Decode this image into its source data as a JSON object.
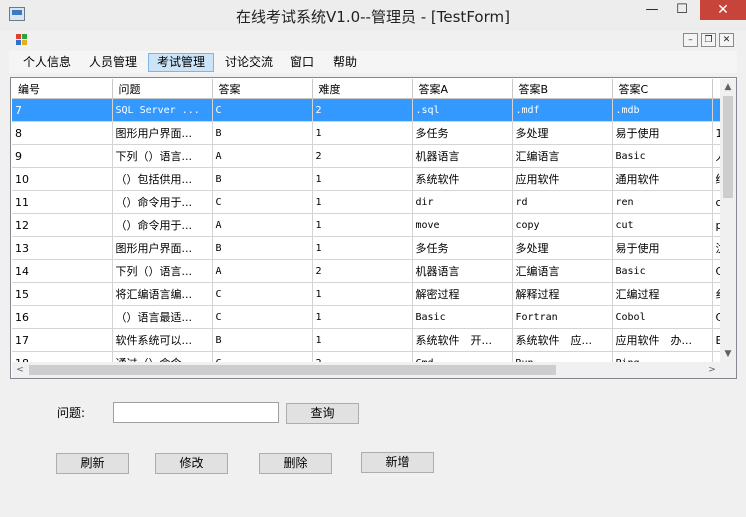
{
  "window": {
    "title": "在线考试系统V1.0--管理员 - [TestForm]",
    "minimize": "—",
    "maximize": "☐",
    "close": "✕"
  },
  "menu": [
    "个人信息",
    "人员管理",
    "考试管理",
    "讨论交流",
    "窗口",
    "帮助"
  ],
  "grid": {
    "columns": [
      "编号",
      "问题",
      "答案",
      "难度",
      "答案A",
      "答案B",
      "答案C",
      ""
    ],
    "rows": [
      [
        "7",
        "SQL Server ...",
        "C",
        "2",
        ".sql",
        ".mdf",
        ".mdb",
        ""
      ],
      [
        "8",
        "图形用户界面...",
        "B",
        "1",
        "多任务",
        "多处理",
        "易于使用",
        "1"
      ],
      [
        "9",
        "下列（）语言...",
        "A",
        "2",
        "机器语言",
        "汇编语言",
        "Basic",
        "人"
      ],
      [
        "10",
        "（）包括供用...",
        "B",
        "1",
        "系统软件",
        "应用软件",
        "通用软件",
        "绉"
      ],
      [
        "11",
        "（）命令用于...",
        "C",
        "1",
        "dir",
        "rd",
        "ren",
        "c"
      ],
      [
        "12",
        "（）命令用于...",
        "A",
        "1",
        "move",
        "copy",
        "cut",
        "p"
      ],
      [
        "13",
        "图形用户界面...",
        "B",
        "1",
        "多任务",
        "多处理",
        "易于使用",
        "汶"
      ],
      [
        "14",
        "下列（）语言...",
        "A",
        "2",
        "机器语言",
        "汇编语言",
        "Basic",
        "C"
      ],
      [
        "15",
        "将汇编语言编...",
        "C",
        "1",
        "解密过程",
        "解释过程",
        "汇编过程",
        "纟"
      ],
      [
        "16",
        "（）语言最适...",
        "C",
        "1",
        "Basic",
        "Fortran",
        "Cobol",
        "C"
      ],
      [
        "17",
        "软件系统可以...",
        "B",
        "1",
        "系统软件　开...",
        "系统软件　应...",
        "应用软件　办...",
        "E"
      ],
      [
        "18",
        "通过（）命令...",
        "C",
        "2",
        "Cmd",
        "Run",
        "Ping",
        ""
      ]
    ]
  },
  "search": {
    "label": "问题:",
    "value": "",
    "button": "查询"
  },
  "actions": {
    "refresh": "刷新",
    "edit": "修改",
    "delete": "删除",
    "add": "新增"
  },
  "scroll": {
    "up": "▲",
    "down": "▼",
    "left": "<",
    "right": ">"
  }
}
